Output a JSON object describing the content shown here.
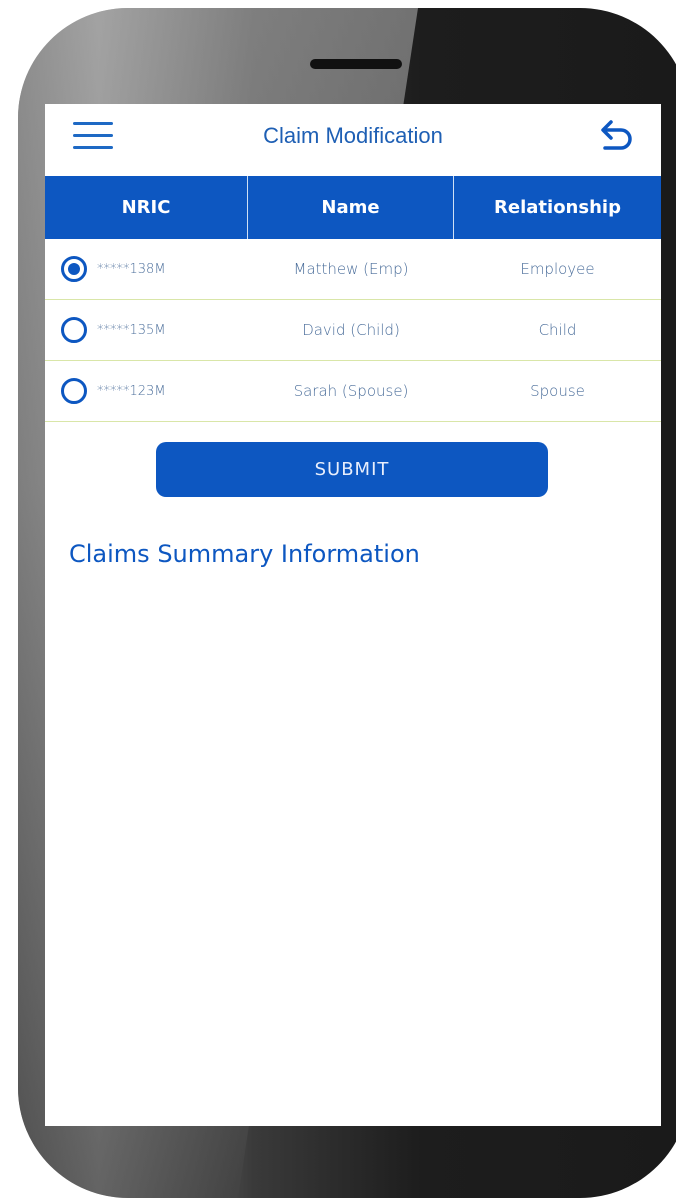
{
  "header": {
    "title": "Claim Modification"
  },
  "table": {
    "columns": [
      "NRIC",
      "Name",
      "Relationship"
    ],
    "rows": [
      {
        "selected": true,
        "nric": "*****138M",
        "name": "Matthew (Emp)",
        "relationship": "Employee"
      },
      {
        "selected": false,
        "nric": "*****135M",
        "name": "David (Child)",
        "relationship": "Child"
      },
      {
        "selected": false,
        "nric": "*****123M",
        "name": "Sarah (Spouse)",
        "relationship": "Spouse"
      }
    ]
  },
  "submit_label": "SUBMIT",
  "section_title": "Claims Summary Information",
  "icons": {
    "menu": "menu-icon",
    "back": "undo-icon",
    "radio": "radio-icon"
  },
  "colors": {
    "primary": "#0d57c1",
    "text_blue": "#1e5fb4",
    "row_divider": "#d9e6a8"
  }
}
